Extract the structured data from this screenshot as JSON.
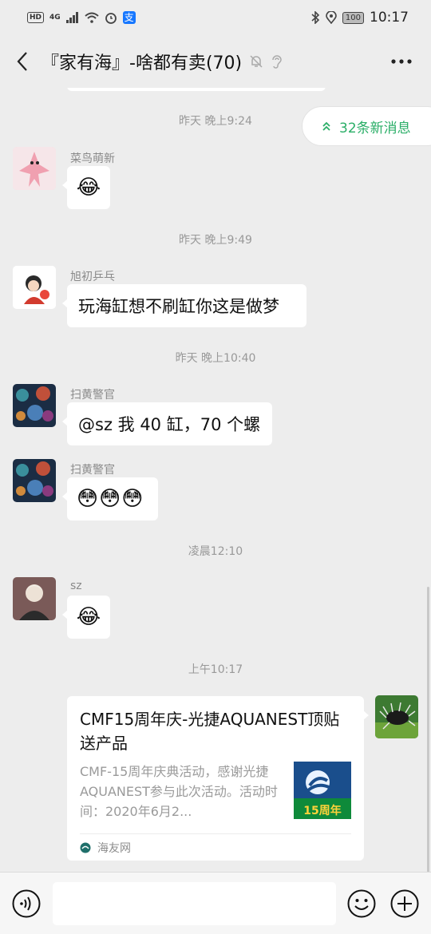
{
  "status_bar": {
    "hd": "HD",
    "network": "4G",
    "alipay": "支",
    "battery": "100",
    "time": "10:17"
  },
  "nav": {
    "title": "『家有海』-啥都有卖(70)"
  },
  "new_messages": {
    "label": "32条新消息"
  },
  "messages": [
    {
      "type": "time",
      "text": "昨天 晚上9:24"
    },
    {
      "sender": "菜鸟萌新",
      "content": "😂"
    },
    {
      "type": "time",
      "text": "昨天 晚上9:49"
    },
    {
      "sender": "旭初乒乓",
      "content": "玩海缸想不刷缸你这是做梦"
    },
    {
      "type": "time",
      "text": "昨天 晚上10:40"
    },
    {
      "sender": "扫黄警官",
      "content": "@sz  我 40 缸，70 个螺"
    },
    {
      "sender": "扫黄警官",
      "content": "😳😳😳"
    },
    {
      "type": "time",
      "text": "凌晨12:10"
    },
    {
      "sender": "sz",
      "content": "😂"
    },
    {
      "type": "time",
      "text": "上午10:17"
    }
  ],
  "link_card": {
    "title": "CMF15周年庆-光捷AQUANEST顶贴送产品",
    "description": "CMF-15周年庆典活动，感谢光捷AQUANEST参与此次活动。活动时间：2020年6月2...",
    "thumb_text": "15周年",
    "source": "海友网"
  },
  "input": {
    "placeholder": ""
  },
  "colors": {
    "background": "#ededed",
    "bubble": "#ffffff",
    "accent_green": "#2aae67",
    "timestamp": "#999999"
  }
}
